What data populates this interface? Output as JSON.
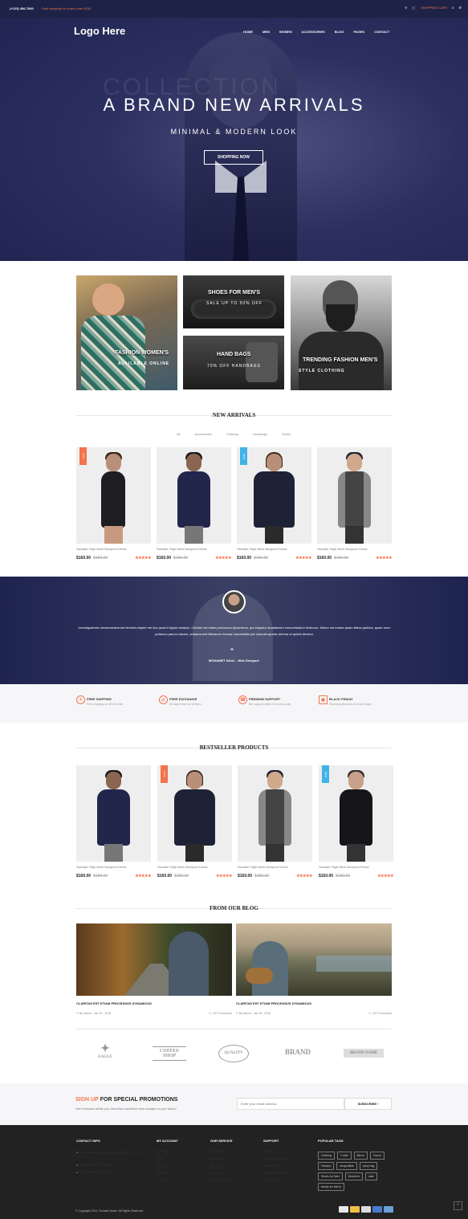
{
  "topbar": {
    "phone": "(+123) 456-7890",
    "promo": "Free shipping for orders over $150",
    "cart": "SHOPPING CART",
    "cart_count": "0"
  },
  "header": {
    "logo": "Logo Here",
    "nav": [
      "HOME",
      "MEN",
      "WOMEN",
      "ACCESSORIES",
      "BLOG",
      "PAGES",
      "CONTACT"
    ]
  },
  "hero": {
    "bg_word": "COLLECTION",
    "title": "A BRAND NEW ARRIVALS",
    "subtitle": "MINIMAL & MODERN LOOK",
    "button": "SHOPPING NOW"
  },
  "banners": {
    "women": {
      "title": "FASHION WOMEN'S",
      "sub": "AVAILABLE ONLINE"
    },
    "shoes": {
      "title": "SHOES FOR MEN'S",
      "sub": "SALE UP TO 50% OFF"
    },
    "bags": {
      "title": "HAND BAGS",
      "sub": "70% OFF HANDBAGS"
    },
    "men": {
      "title": "TRENDING FASHION MEN'S",
      "sub": "STYLE CLOTHING"
    }
  },
  "new_arrivals": {
    "title": "NEW ARRIVALS",
    "filters": [
      "All",
      "Accessories",
      "Clothing",
      "Handbags",
      "Shoes"
    ],
    "products": [
      {
        "badge": "SALE",
        "name": "Sweater High Neck Bodycon Dress",
        "price": "$160.00",
        "old": "$180.00",
        "stars": "★★★★★"
      },
      {
        "badge": "",
        "name": "Sweater High Neck Bodycon Dress",
        "price": "$160.00",
        "old": "$180.00",
        "stars": "★★★★★"
      },
      {
        "badge": "NEW",
        "name": "Sweater High Neck Bodycon Dress",
        "price": "$160.00",
        "old": "$180.00",
        "stars": "★★★★★"
      },
      {
        "badge": "",
        "name": "Sweater High Neck Bodycon Dress",
        "price": "$160.00",
        "old": "$180.00",
        "stars": "★★★★★"
      }
    ]
  },
  "testimonial": {
    "text": "Investigationes demonstraverunt lectores legere me lius quod ii legunt saepius. Claritas est etiam processus dynamicus, qui sequitur mutationem consuetudium lectorum. Mirum est notare quam littera gothica, quam nunc putamus parum claram, anteposuerit litterarum formas humanitatis per seacula quarta decima et quinta decima.",
    "author": "MOHAMET NAUL - Web Designer"
  },
  "features": [
    {
      "title": "FREE SHIPPING",
      "desc": "Free shipping on all US order",
      "icon": "plane-icon"
    },
    {
      "title": "FREE EXCHANGE",
      "desc": "30 days return on all Item",
      "icon": "exchange-icon"
    },
    {
      "title": "PREMIUM SUPPORT",
      "desc": "We support online 24 hours a day",
      "icon": "headset-icon"
    },
    {
      "title": "BLACK FRIDAY",
      "desc": "Shocking discount on every friday",
      "icon": "bag-icon"
    }
  ],
  "bestseller": {
    "title": "BESTSELLER PRODUCTS",
    "products": [
      {
        "badge": "",
        "name": "Sweater High Neck Bodycon Dress",
        "price": "$160.00",
        "old": "$180.00",
        "stars": "★★★★★"
      },
      {
        "badge": "SALE",
        "name": "Sweater High Neck Bodycon Dress",
        "price": "$160.00",
        "old": "$180.00",
        "stars": "★★★★★"
      },
      {
        "badge": "",
        "name": "Sweater High Neck Bodycon Dress",
        "price": "$160.00",
        "old": "$180.00",
        "stars": "★★★★★"
      },
      {
        "badge": "NEW",
        "name": "Sweater High Neck Bodycon Dress",
        "price": "$160.00",
        "old": "$180.00",
        "stars": "★★★★★"
      }
    ]
  },
  "blog": {
    "title": "FROM OUR BLOG",
    "posts": [
      {
        "title": "CLARITAS EST ETIAM PROCESSUS DYNAMICUS",
        "author": "By Admin",
        "date": "Jan 30 , 2018",
        "comments": "257 Comments"
      },
      {
        "title": "CLARITAS EST ETIAM PROCESSUS DYNAMICUS",
        "author": "By Admin",
        "date": "Jan 30 , 2018",
        "comments": "257 Comments"
      }
    ]
  },
  "brands": [
    "EAGLE",
    "COFFEE SHOP",
    "QUALITY",
    "BRAND",
    "BRAND NAME"
  ],
  "newsletter": {
    "title_accent": "SIGN UP",
    "title_rest": " FOR SPECIAL PROMOTIONS",
    "sub": "Get exclusive deals you wont find anywhere else straight to your inbox!",
    "placeholder": "Enter your email address",
    "button": "SUBSCRIBE !"
  },
  "footer": {
    "contact": {
      "title": "CONTACT INFO",
      "address": "59921 Marmora Road, Glasgow D04 89 GR, New York",
      "phone": "Telephones: + 1234567890",
      "email": "Email: demo@example.com"
    },
    "account": {
      "title": "MY ACCOUNT",
      "items": [
        "My Account",
        "Login",
        "My Cart",
        "Wishlist",
        "Checkout"
      ]
    },
    "service": {
      "title": "OUR SERVICE",
      "items": [
        "Contact us",
        "Discount",
        "Site map",
        "About us",
        "Custom service"
      ]
    },
    "support": {
      "title": "SUPPORT",
      "items": [
        "About us",
        "Delivery information",
        "Privacy policy",
        "Terms & conditions",
        "Support 24/7"
      ]
    },
    "tags": {
      "title": "POPULAR TAGS",
      "items": [
        "Clothing",
        "T-shirt",
        "Men's",
        "Favori",
        "Fashion",
        "shopcollkie",
        "carry bag",
        "Shoes for Men",
        "Women's",
        "sale",
        "trendy for Men's"
      ]
    },
    "copyright": "© Copyright 2021, Domain Name. All Rights Reserved."
  },
  "colors": {
    "accent": "#f2744b",
    "navy": "#1e2247",
    "new_badge": "#41b3e8"
  }
}
